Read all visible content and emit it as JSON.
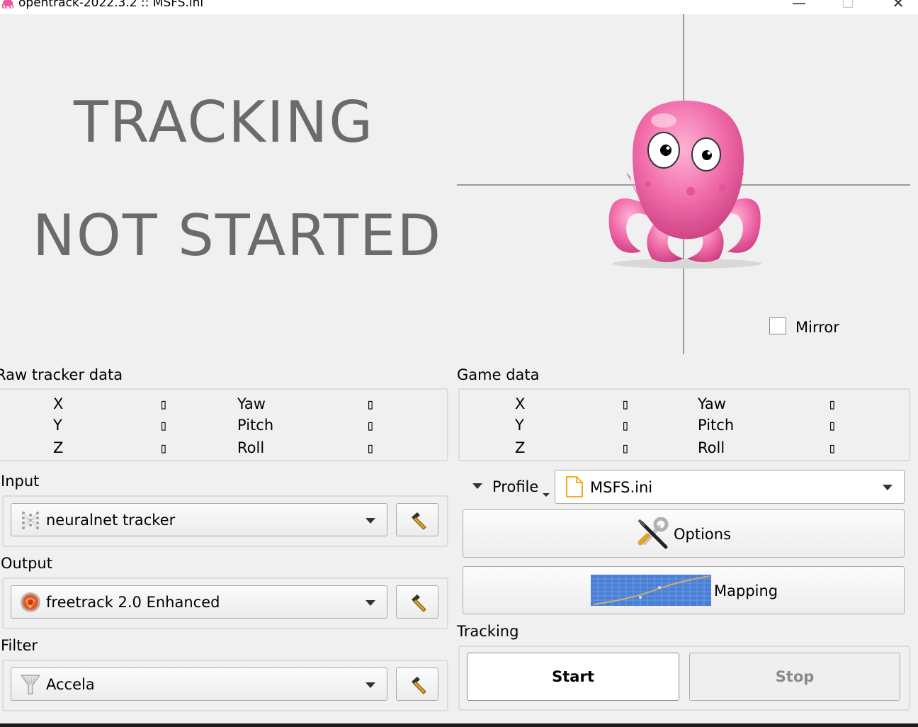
{
  "window": {
    "title": "opentrack-2022.3.2 :: MSFS.ini",
    "minimize_glyph": "—",
    "maximize_glyph": "☐",
    "close_glyph": "✕"
  },
  "status": {
    "line1": "TRACKING",
    "line2": "NOT STARTED"
  },
  "mirror": {
    "label": "Mirror",
    "checked": false
  },
  "raw_tracker": {
    "title": "Raw tracker data",
    "labels": [
      "X",
      "Y",
      "Z",
      "Yaw",
      "Pitch",
      "Roll"
    ],
    "values": [
      "▯",
      "▯",
      "▯",
      "▯",
      "▯",
      "▯"
    ]
  },
  "game_data": {
    "title": "Game data",
    "labels": [
      "X",
      "Y",
      "Z",
      "Yaw",
      "Pitch",
      "Roll"
    ],
    "values": [
      "▯",
      "▯",
      "▯",
      "▯",
      "▯",
      "▯"
    ]
  },
  "input": {
    "title": "Input",
    "selected": "neuralnet tracker"
  },
  "output": {
    "title": "Output",
    "selected": "freetrack 2.0 Enhanced"
  },
  "filter": {
    "title": "Filter",
    "selected": "Accela"
  },
  "profile": {
    "label": "Profile",
    "selected": "MSFS.ini"
  },
  "buttons": {
    "options": "Options",
    "mapping": "Mapping",
    "start": "Start",
    "stop": "Stop"
  },
  "tracking": {
    "title": "Tracking"
  },
  "colors": {
    "octopus_pink": "#f06aa8",
    "status_gray": "#6b6b6b",
    "mapping_blue": "#4a7fd6"
  }
}
